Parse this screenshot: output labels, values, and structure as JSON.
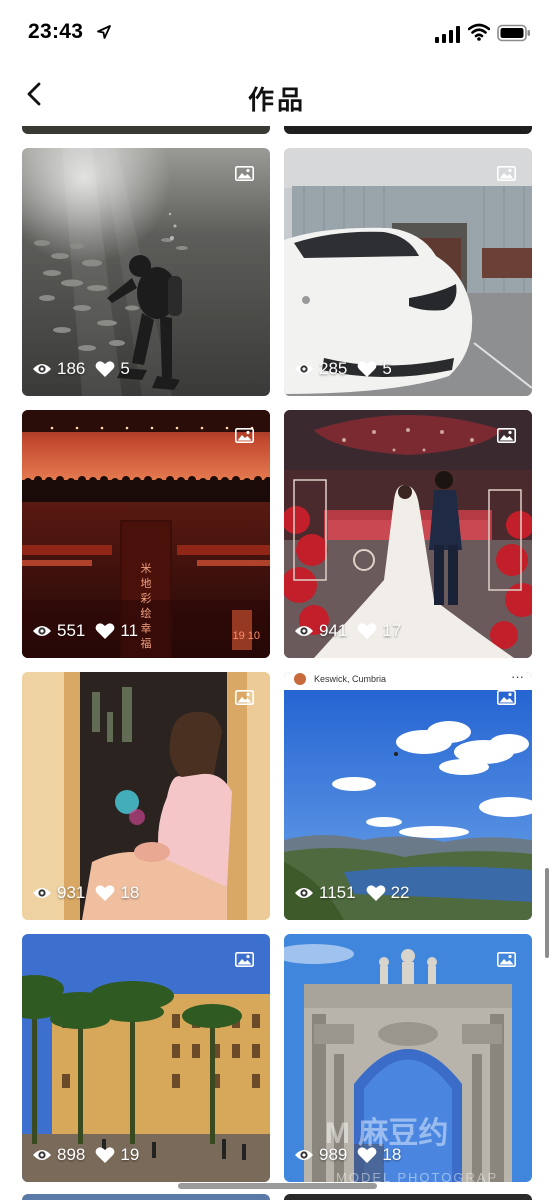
{
  "status_bar": {
    "time": "23:43"
  },
  "header": {
    "title": "作品"
  },
  "works": [
    {
      "views": "186",
      "likes": "5"
    },
    {
      "views": "285",
      "likes": "5"
    },
    {
      "views": "551",
      "likes": "11"
    },
    {
      "views": "941",
      "likes": "17"
    },
    {
      "views": "931",
      "likes": "18",
      "overlay_lines": [
        "彩"
      ]
    },
    {
      "views": "1151",
      "likes": "22",
      "overlay_header": "Keswick, Cumbria",
      "overlay_more": "···"
    },
    {
      "views": "898",
      "likes": "19"
    },
    {
      "views": "989",
      "likes": "18"
    }
  ],
  "photo3_sign": "米 地 彩 绘 幸 福",
  "photo3_sign_small": "19 10",
  "watermark": {
    "main": "M 麻豆约",
    "sub": "MODEL PHOTOGRAP"
  },
  "colors": {
    "background": "#ffffff",
    "text": "#111111",
    "overlay_text": "#ffffff"
  },
  "icons": [
    "location-arrow-icon",
    "signal-icon",
    "wifi-icon",
    "battery-icon",
    "back-chevron-icon",
    "image-type-icon",
    "eye-icon",
    "heart-icon"
  ]
}
